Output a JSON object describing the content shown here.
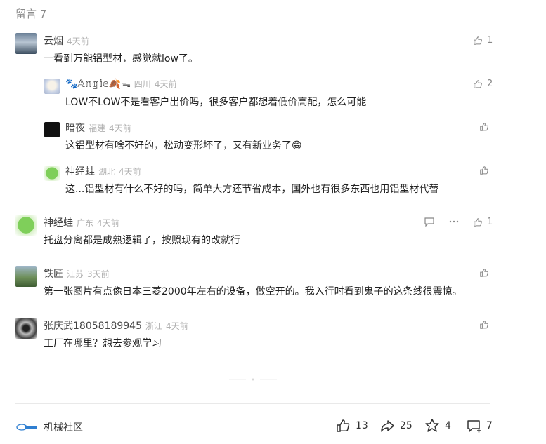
{
  "header": {
    "title": "留言 7"
  },
  "comments": [
    {
      "name": "云烟",
      "location": "",
      "time": "4天前",
      "text": "一看到万能铝型材，感觉就low了。",
      "likes": "1"
    },
    {
      "name": "🐾𝔸𝕟𝕘𝕚𝕖🍂ᯓ",
      "location": "四川",
      "time": "4天前",
      "text": "LOW不LOW不是看客户出价吗，很多客户都想着低价高配，怎么可能",
      "likes": "2"
    },
    {
      "name": "暗夜",
      "location": "福建",
      "time": "4天前",
      "text": "这铝型材有啥不好的，松动变形坏了，又有新业务了😁",
      "likes": ""
    },
    {
      "name": "神经蛙",
      "location": "湖北",
      "time": "4天前",
      "text": "这...铝型材有什么不好的吗，简单大方还节省成本，国外也有很多东西也用铝型材代替",
      "likes": ""
    },
    {
      "name": "神经蛙",
      "location": "广东",
      "time": "4天前",
      "text": "托盘分离都是成熟逻辑了，按照现有的改就行",
      "likes": "1"
    },
    {
      "name": "铁匠",
      "location": "江苏",
      "time": "3天前",
      "text": "第一张图片有点像日本三菱2000年左右的设备，做空开的。我入行时看到鬼子的这条线很震惊。",
      "likes": ""
    },
    {
      "name": "张庆武18058189945",
      "location": "浙江",
      "time": "4天前",
      "text": "工厂在哪里？想去参观学习",
      "likes": ""
    }
  ],
  "footer": {
    "community": "机械社区",
    "likes": "13",
    "shares": "25",
    "favorites": "4",
    "comments": "7"
  },
  "icons": [
    "thumb-up-icon",
    "comment-icon",
    "more-dots-icon",
    "share-icon",
    "favorite-icon"
  ]
}
